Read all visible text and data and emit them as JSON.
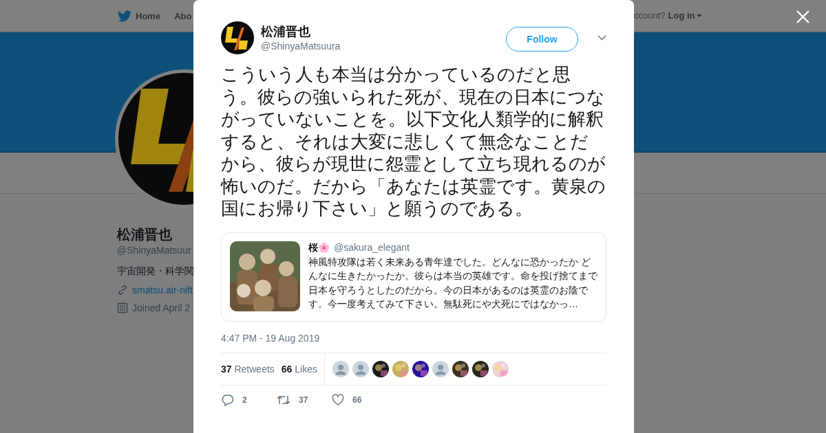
{
  "background_page": {
    "nav": {
      "home": "Home",
      "about": "Abo",
      "account_prompt": "ccount?",
      "login": "Log in"
    },
    "profile": {
      "name": "松浦晋也",
      "handle": "@ShinyaMatsuur",
      "bio": "宇宙開発・科学関",
      "link": "smatsu.air-nift",
      "joined": "Joined April 2"
    }
  },
  "tweet": {
    "author": {
      "name": "松浦晋也",
      "handle": "@ShinyaMatsuura"
    },
    "follow_button": "Follow",
    "text": "こういう人も本当は分かっているのだと思う。彼らの強いられた死が、現在の日本につながっていないことを。以下文化人類学的に解釈すると、それは大変に悲しくて無念なことだから、彼らが現世に怨霊として立ち現れるのが怖いのだ。だから「あなたは英霊です。黄泉の国にお帰り下さい」と願うのである。",
    "quoted": {
      "kind": "picture",
      "name": "桜🌸",
      "handle": "@sakura_elegant",
      "text": "神風特攻隊は若く未来ある青年達でした。どんなに恐かったか どんなに生きたかったか。彼らは本当の英雄です。命を投げ捨てまで日本を守ろうとしたのだから。今の日本があるのは英霊のお陰です。今一度考えてみて下さい。無駄死にや犬死にではなかっ…"
    },
    "timestamp": "4:47 PM - 19 Aug 2019",
    "retweets": {
      "count": "37",
      "label": "Retweets"
    },
    "likes": {
      "count": "66",
      "label": "Likes"
    },
    "liked_by": [
      {
        "kind": "default"
      },
      {
        "kind": "default"
      },
      {
        "kind": "picture",
        "color": "#1a1a1a"
      },
      {
        "kind": "picture",
        "color": "#c8b060"
      },
      {
        "kind": "picture",
        "color": "#2a10a0"
      },
      {
        "kind": "default"
      },
      {
        "kind": "picture",
        "color": "#3a3020"
      },
      {
        "kind": "picture",
        "color": "#2a2418"
      },
      {
        "kind": "picture",
        "color": "#f0d0d8"
      }
    ],
    "actions": [
      {
        "kind": "reply",
        "count": "2"
      },
      {
        "kind": "retweet",
        "count": "37"
      },
      {
        "kind": "like",
        "count": "66"
      }
    ]
  }
}
